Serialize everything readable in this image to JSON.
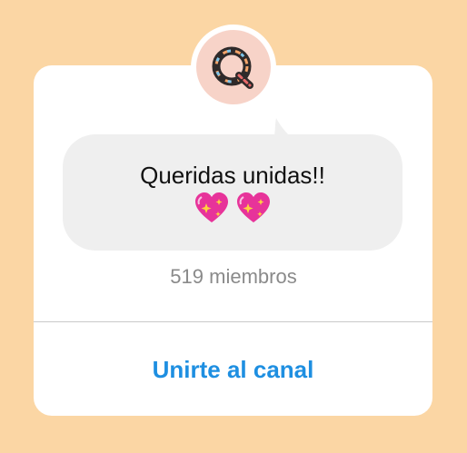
{
  "channel": {
    "message_text": "Queridas unidas!!",
    "message_emoji": [
      "sparkling-heart",
      "sparkling-heart"
    ],
    "members_label": "519 miembros",
    "join_label": "Unirte al canal"
  },
  "colors": {
    "background": "#fbd6a4",
    "card": "#ffffff",
    "bubble": "#efefef",
    "join_link": "#1e8fe1",
    "members_text": "#8a8a8a",
    "heart": "#e7339a"
  }
}
